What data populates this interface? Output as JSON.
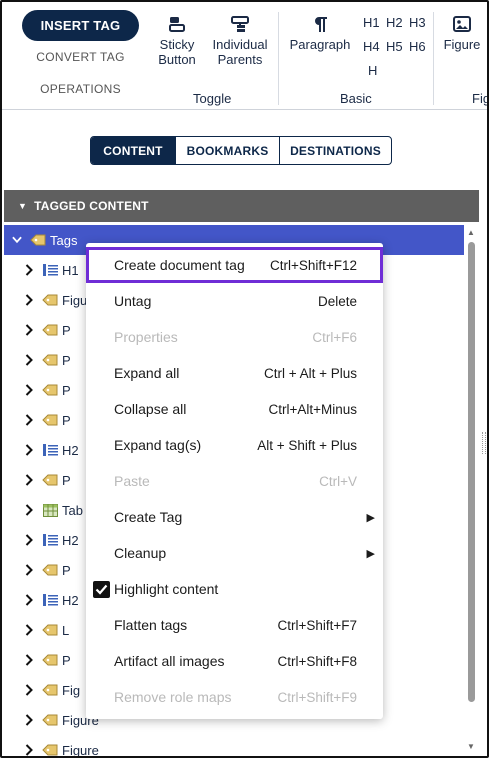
{
  "ribbon": {
    "operations": {
      "insert_tag": "INSERT TAG",
      "convert_tag": "CONVERT TAG",
      "label": "OPERATIONS"
    },
    "toggle": {
      "sticky_button": "Sticky\nButton",
      "individual_parents": "Individual\nParents",
      "label": "Toggle"
    },
    "basic": {
      "paragraph": "Paragraph",
      "headings": [
        "H1",
        "H2",
        "H3",
        "H4",
        "H5",
        "H6",
        "H"
      ],
      "label": "Basic"
    },
    "figure": {
      "figure": "Figure",
      "label": "Fig"
    }
  },
  "tabs": [
    "CONTENT",
    "BOOKMARKS",
    "DESTINATIONS"
  ],
  "tagged_content": {
    "header": "TAGGED CONTENT",
    "root_label": "Tags",
    "rows": [
      {
        "icon": "heading-icon",
        "label": "H1"
      },
      {
        "icon": "tag-icon",
        "label": "Figu"
      },
      {
        "icon": "tag-icon",
        "label": "P"
      },
      {
        "icon": "tag-icon",
        "label": "P"
      },
      {
        "icon": "tag-icon",
        "label": "P"
      },
      {
        "icon": "tag-icon",
        "label": "P"
      },
      {
        "icon": "heading-icon",
        "label": "H2"
      },
      {
        "icon": "tag-icon",
        "label": "P"
      },
      {
        "icon": "table-icon",
        "label": "Tab"
      },
      {
        "icon": "heading-icon",
        "label": "H2"
      },
      {
        "icon": "tag-icon",
        "label": "P"
      },
      {
        "icon": "heading-icon",
        "label": "H2"
      },
      {
        "icon": "tag-icon",
        "label": "L"
      },
      {
        "icon": "tag-icon",
        "label": "P"
      },
      {
        "icon": "tag-icon",
        "label": "Fig"
      },
      {
        "icon": "tag-icon",
        "label": "Figure"
      },
      {
        "icon": "tag-icon",
        "label": "Figure"
      }
    ]
  },
  "context_menu": {
    "items": [
      {
        "label": "Create document tag",
        "shortcut": "Ctrl+Shift+F12",
        "state": "focused"
      },
      {
        "label": "Untag",
        "shortcut": "Delete",
        "state": "enabled"
      },
      {
        "label": "Properties",
        "shortcut": "Ctrl+F6",
        "state": "disabled"
      },
      {
        "label": "Expand all",
        "shortcut": "Ctrl + Alt + Plus",
        "state": "enabled"
      },
      {
        "label": "Collapse all",
        "shortcut": "Ctrl+Alt+Minus",
        "state": "enabled"
      },
      {
        "label": "Expand tag(s)",
        "shortcut": "Alt + Shift + Plus",
        "state": "enabled"
      },
      {
        "label": "Paste",
        "shortcut": "Ctrl+V",
        "state": "disabled"
      },
      {
        "label": "Create Tag",
        "shortcut": "",
        "state": "submenu"
      },
      {
        "label": "Cleanup",
        "shortcut": "",
        "state": "submenu"
      },
      {
        "label": "Highlight content",
        "shortcut": "",
        "state": "checked"
      },
      {
        "label": "Flatten tags",
        "shortcut": "Ctrl+Shift+F7",
        "state": "enabled"
      },
      {
        "label": "Artifact all images",
        "shortcut": "Ctrl+Shift+F8",
        "state": "enabled"
      },
      {
        "label": "Remove role maps",
        "shortcut": "Ctrl+Shift+F9",
        "state": "disabled"
      }
    ],
    "submenu_arrow": "▶",
    "check_mark": "✓"
  },
  "colors": {
    "navy": "#0d2749",
    "selection": "#4356c8",
    "focus_outline": "#6f2dd6",
    "header_gray": "#5f5f5f",
    "tag_icon": "#d9b45a"
  }
}
